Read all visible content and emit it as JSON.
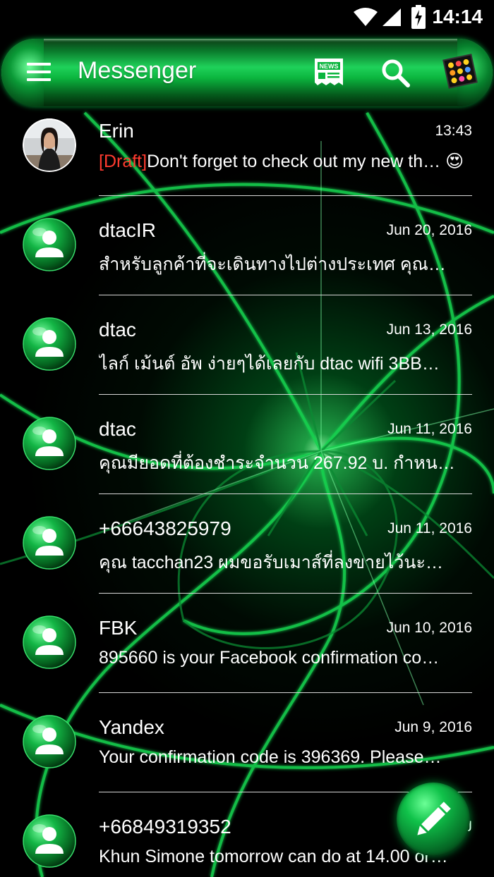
{
  "status_bar": {
    "time": "14:14"
  },
  "app_bar": {
    "title": "Messenger",
    "news_label": "NEWS"
  },
  "conversations": [
    {
      "name": "Erin",
      "date": "13:43",
      "draft_tag": "[Draft]",
      "snippet": "Don't forget to check out my new th… 😍",
      "has_photo": true
    },
    {
      "name": "dtacIR",
      "date": "Jun 20, 2016",
      "draft_tag": "",
      "snippet": "สำหรับลูกค้าที่จะเดินทางไปต่างประเทศ คุณ…"
    },
    {
      "name": "dtac",
      "date": "Jun 13, 2016",
      "draft_tag": "",
      "snippet": "ไลก์ เม้นต์ อัพ ง่ายๆได้เลยกับ dtac wifi 3BB…"
    },
    {
      "name": "dtac",
      "date": "Jun 11, 2016",
      "draft_tag": "",
      "snippet": "คุณมียอดที่ต้องชำระจำนวน 267.92 บ. กำหน…"
    },
    {
      "name": "+66643825979",
      "date": "Jun 11, 2016",
      "draft_tag": "",
      "snippet": "คุณ tacchan23 ผมขอรับเมาส์ที่ลงขายไว้นะ…"
    },
    {
      "name": "FBK",
      "date": "Jun 10, 2016",
      "draft_tag": "",
      "snippet": "895660 is your Facebook confirmation co…"
    },
    {
      "name": "Yandex",
      "date": "Jun 9, 2016",
      "draft_tag": "",
      "snippet": "Your confirmation code is 396369. Please…"
    },
    {
      "name": "+66849319352",
      "date": "J",
      "draft_tag": "",
      "snippet": "Khun Simone tomorrow can do at 14.00 or…"
    }
  ],
  "icons": {
    "menu": "menu-icon",
    "news": "news-icon",
    "search": "search-icon",
    "themes": "emoji-theme-icon",
    "compose": "pencil-icon",
    "contact": "person-icon"
  },
  "colors": {
    "accent": "#1fd25a",
    "draft": "#ff3b2f",
    "background": "#000000"
  }
}
